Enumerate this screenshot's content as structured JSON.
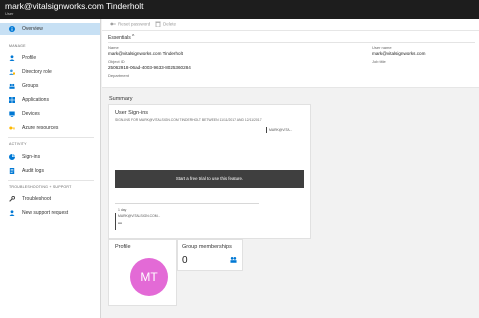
{
  "header": {
    "title": "mark@vitalsignworks.com Tinderholt",
    "subtitle": "User"
  },
  "sidebar": {
    "items": [
      {
        "label": "Overview",
        "icon": "info-icon",
        "active": true
      },
      {
        "section": "MANAGE"
      },
      {
        "label": "Profile",
        "icon": "person-icon"
      },
      {
        "label": "Directory role",
        "icon": "directory-role-icon"
      },
      {
        "label": "Groups",
        "icon": "groups-icon"
      },
      {
        "label": "Applications",
        "icon": "applications-icon"
      },
      {
        "label": "Devices",
        "icon": "devices-icon"
      },
      {
        "label": "Azure resources",
        "icon": "key-icon"
      },
      {
        "section": "ACTIVITY"
      },
      {
        "label": "Sign-ins",
        "icon": "sign-ins-icon"
      },
      {
        "label": "Audit logs",
        "icon": "audit-logs-icon"
      },
      {
        "section": "TROUBLESHOOTING + SUPPORT"
      },
      {
        "label": "Troubleshoot",
        "icon": "wrench-icon"
      },
      {
        "label": "New support request",
        "icon": "person-support-icon"
      }
    ]
  },
  "toolbar": {
    "reset_password": "Reset password",
    "delete": "Delete"
  },
  "essentials": {
    "heading": "Essentials",
    "chevron": "^",
    "name_label": "Name",
    "name_value": "mark@vitalsignworks.com Tinderholt",
    "object_id_label": "Object ID",
    "object_id_value": "25062918-06ad-4003-9633-8025360284",
    "department_label": "Department",
    "user_name_label": "User name",
    "user_name_value": "mark@vitalsignworks.com",
    "job_title_label": "Job title"
  },
  "summary": {
    "title": "Summary",
    "signins": {
      "title": "User Sign-ins",
      "subtitle": "SIGN-INS FOR MARK@VITALSIGN.COM TINDERHOLT BETWEEN 11/11/2017 AND 12/11/2017",
      "legend_top": "MARK@VITA...",
      "trial_text": "Start a free trial to use this feature.",
      "legend_bottom_label": "1 day",
      "legend_bottom_value": "MARK@VITALSIGN.COM...",
      "legend_bottom_count": "--"
    },
    "profile": {
      "title": "Profile",
      "initials": "MT",
      "avatar_color": "#e36ad6"
    },
    "groups": {
      "title": "Group memberships",
      "count": "0"
    }
  },
  "colors": {
    "header_bg": "#1d1d1d",
    "active_item_bg": "#c7e0f4",
    "accent_blue": "#0078d4"
  }
}
